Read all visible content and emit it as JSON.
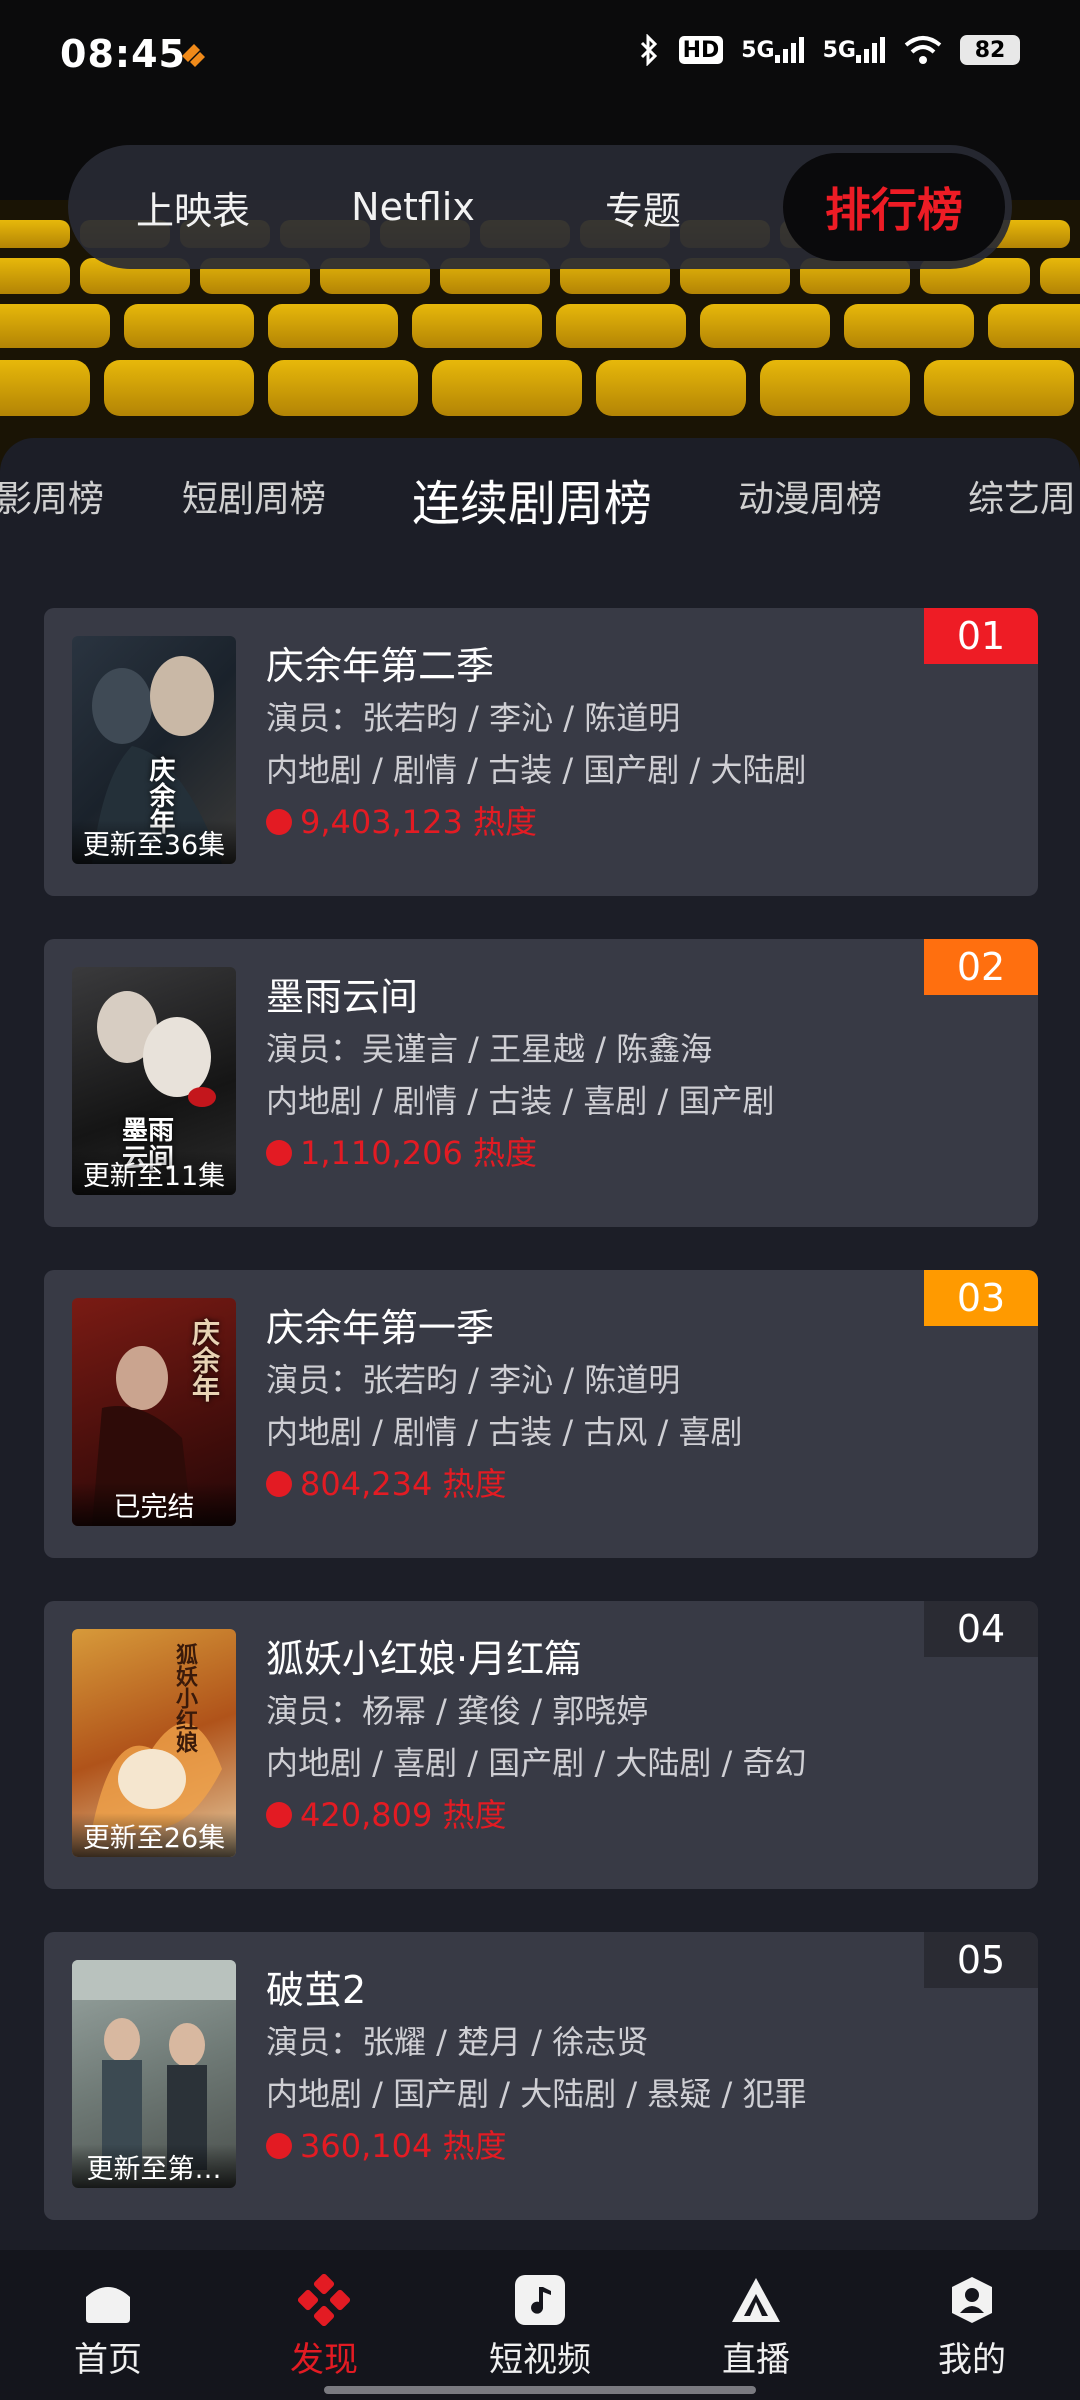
{
  "status_bar": {
    "time": "08:45",
    "battery": "82",
    "icons": [
      "bluetooth-icon",
      "hd-icon",
      "signal-5g-icon",
      "signal-5g-icon",
      "wifi-icon"
    ],
    "hd_label": "HD",
    "net_label": "5G"
  },
  "top_nav": {
    "tabs": [
      "上映表",
      "Netflix",
      "专题",
      "排行榜"
    ],
    "active_index": 3
  },
  "sub_tabs": {
    "items": [
      "影周榜",
      "短剧周榜",
      "连续剧周榜",
      "动漫周榜",
      "综艺周"
    ],
    "active_index": 2
  },
  "list": [
    {
      "rank": "01",
      "rank_color": "#ee1c25",
      "title": "庆余年第二季",
      "actors": "演员：张若昀 / 李沁 / 陈道明",
      "tags": "内地剧 / 剧情 / 古装 / 国产剧 / 大陆剧",
      "heat": "9,403,123 热度",
      "status": "更新至36集",
      "poster_text": "庆余年"
    },
    {
      "rank": "02",
      "rank_color": "#ff6f0f",
      "title": "墨雨云间",
      "actors": "演员：吴谨言 / 王星越 / 陈鑫海",
      "tags": "内地剧 / 剧情 / 古装 / 喜剧 / 国产剧",
      "heat": "1,110,206 热度",
      "status": "更新至11集",
      "poster_text": "墨雨云间"
    },
    {
      "rank": "03",
      "rank_color": "#ff9a00",
      "title": "庆余年第一季",
      "actors": "演员：张若昀 / 李沁 / 陈道明",
      "tags": "内地剧 / 剧情 / 古装 / 古风 / 喜剧",
      "heat": "804,234 热度",
      "status": "已完结",
      "poster_text": "庆余年"
    },
    {
      "rank": "04",
      "rank_color": "#2a2b33",
      "title": "狐妖小红娘·月红篇",
      "actors": "演员：杨幂 / 龚俊 / 郭晓婷",
      "tags": "内地剧 / 喜剧 / 国产剧 / 大陆剧 / 奇幻",
      "heat": "420,809 热度",
      "status": "更新至26集",
      "poster_text": "狐妖小红娘"
    },
    {
      "rank": "05",
      "rank_color": "#2a2b33",
      "title": "破茧2",
      "actors": "演员：张耀 / 楚月 / 徐志贤",
      "tags": "内地剧 / 国产剧 / 大陆剧 / 悬疑 / 犯罪",
      "heat": "360,104 热度",
      "status": "更新至第…",
      "poster_text": ""
    }
  ],
  "bottom_nav": {
    "items": [
      {
        "label": "首页",
        "icon": "home-icon"
      },
      {
        "label": "发现",
        "icon": "discover-icon"
      },
      {
        "label": "短视频",
        "icon": "music-note-icon"
      },
      {
        "label": "直播",
        "icon": "live-icon"
      },
      {
        "label": "我的",
        "icon": "profile-icon"
      }
    ],
    "active_index": 1
  },
  "colors": {
    "accent": "#e31b23",
    "card": "#383a45",
    "panel": "#1c1e27"
  }
}
